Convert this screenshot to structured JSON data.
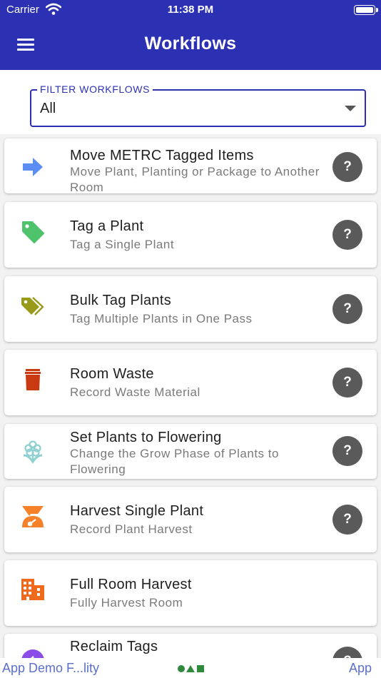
{
  "status_bar": {
    "carrier": "Carrier",
    "time": "11:38 PM"
  },
  "header": {
    "title": "Workflows",
    "menu_icon": "hamburger-menu-icon"
  },
  "filter": {
    "label": "FILTER WORKFLOWS",
    "value": "All"
  },
  "workflows": [
    {
      "title": "Move METRC Tagged Items",
      "subtitle": "Move Plant, Planting or Package to Another Room",
      "icon": "arrow-right-icon",
      "color": "#5b8ef5",
      "help": "?"
    },
    {
      "title": "Tag a Plant",
      "subtitle": "Tag a Single Plant",
      "icon": "tag-icon",
      "color": "#4fc36b",
      "help": "?"
    },
    {
      "title": "Bulk Tag Plants",
      "subtitle": "Tag Multiple Plants in One Pass",
      "icon": "tags-icon",
      "color": "#9a9a1a",
      "help": "?"
    },
    {
      "title": "Room Waste",
      "subtitle": "Record Waste Material",
      "icon": "trash-icon",
      "color": "#c93a12",
      "help": "?"
    },
    {
      "title": "Set Plants to Flowering",
      "subtitle": "Change the Grow Phase of Plants to Flowering",
      "icon": "flower-icon",
      "color": "#8fd0d0",
      "help": "?"
    },
    {
      "title": "Harvest Single Plant",
      "subtitle": "Record Plant Harvest",
      "icon": "harvest-icon",
      "color": "#f5822a",
      "help": "?"
    },
    {
      "title": "Full Room Harvest",
      "subtitle": "Fully Harvest Room",
      "icon": "building-icon",
      "color": "#f06a1e"
    },
    {
      "title": "Reclaim Tags",
      "subtitle": "",
      "icon": "reclaim-icon",
      "color": "#8a4de8",
      "help": "?"
    }
  ],
  "bottom_bar": {
    "left": "App Demo F...lity",
    "right": "App"
  },
  "colors": {
    "primary": "#2c31b4",
    "help_button": "#5a5a5a"
  }
}
